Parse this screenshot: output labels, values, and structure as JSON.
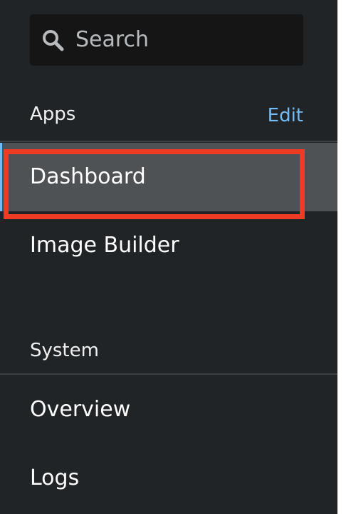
{
  "search": {
    "placeholder": "Search",
    "icon": "search-icon"
  },
  "apps_section": {
    "title": "Apps",
    "edit_label": "Edit"
  },
  "apps_items": [
    {
      "label": "Dashboard",
      "active": true
    },
    {
      "label": "Image Builder",
      "active": false
    }
  ],
  "system_section": {
    "title": "System"
  },
  "system_items": [
    {
      "label": "Overview"
    },
    {
      "label": "Logs"
    }
  ],
  "colors": {
    "sidebar_bg": "#212427",
    "active_bg": "#4f5255",
    "link": "#73bcf7",
    "highlight": "#ee3b24"
  }
}
